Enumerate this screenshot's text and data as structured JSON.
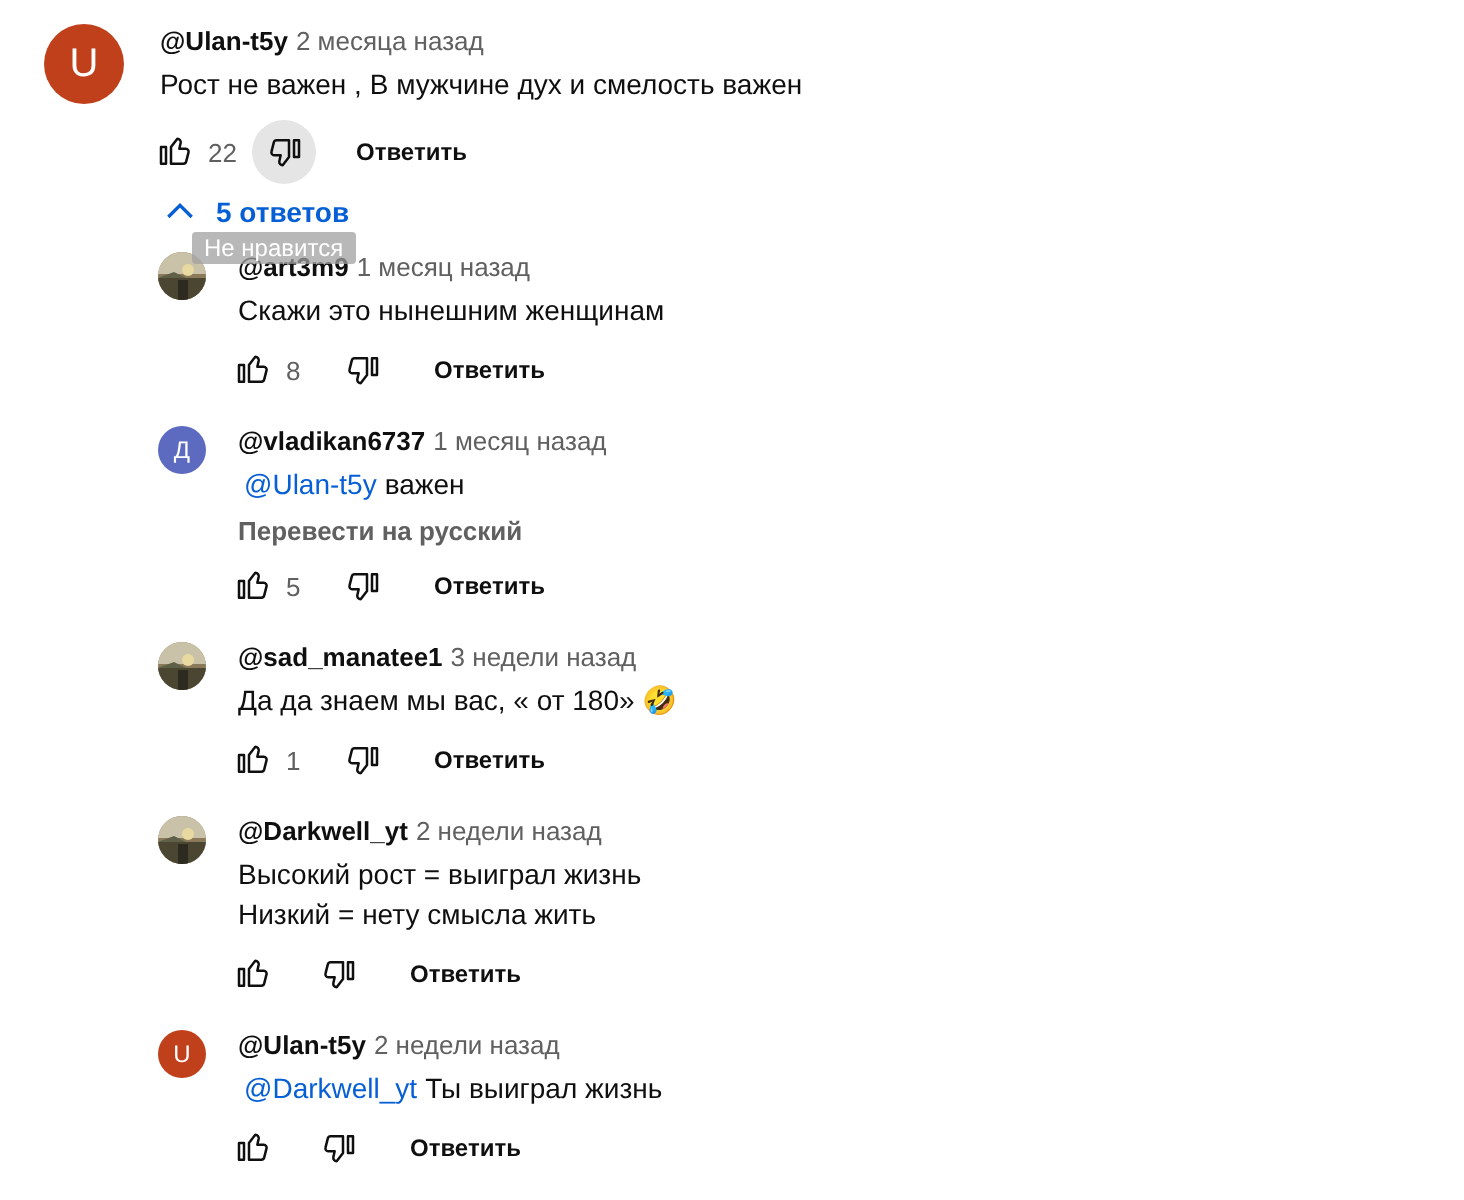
{
  "comment": {
    "avatar": {
      "kind": "letter",
      "letter": "U",
      "color": "#c1401c"
    },
    "author": "@Ulan-t5y",
    "time": "2 месяца назад",
    "text": [
      {
        "kind": "body",
        "text": "Рост не важен , В мужчине дух и смелость важен"
      }
    ],
    "likes": "22",
    "dislike_hovered": true,
    "reply_label": "Ответить",
    "tooltip": "Не нравится"
  },
  "replies_toggle": {
    "label": "5 ответов",
    "expanded": true
  },
  "replies": [
    {
      "avatar": {
        "kind": "picture"
      },
      "author": "@art3m9",
      "time": "1 месяц назад",
      "text": [
        {
          "kind": "body",
          "text": "Скажи это нынешним женщинам"
        }
      ],
      "likes": "8",
      "reply_label": "Ответить"
    },
    {
      "avatar": {
        "kind": "letter",
        "letter": "Д",
        "color": "#5c6bc0"
      },
      "author": "@vladikan6737",
      "time": "1 месяц назад",
      "text": [
        {
          "kind": "mention",
          "text": "@Ulan-t5y"
        },
        {
          "kind": "body",
          "text": "важен"
        }
      ],
      "translate": "Перевести на русский",
      "likes": "5",
      "reply_label": "Ответить"
    },
    {
      "avatar": {
        "kind": "picture"
      },
      "author": "@sad_manatee1",
      "time": "3 недели назад",
      "text": [
        {
          "kind": "body",
          "text": "Да да знаем мы вас, « от 180» 🤣"
        }
      ],
      "likes": "1",
      "reply_label": "Ответить"
    },
    {
      "avatar": {
        "kind": "picture"
      },
      "author": "@Darkwell_yt",
      "time": "2 недели назад",
      "text": [
        {
          "kind": "body",
          "text": "Высокий рост = выиграл жизнь"
        },
        {
          "kind": "break"
        },
        {
          "kind": "body",
          "text": "Низкий = нету смысла жить"
        }
      ],
      "reply_label": "Ответить"
    },
    {
      "avatar": {
        "kind": "letter",
        "letter": "U",
        "color": "#c1401c"
      },
      "author": "@Ulan-t5y",
      "time": "2 недели назад",
      "text": [
        {
          "kind": "mention",
          "text": "@Darkwell_yt"
        },
        {
          "kind": "body",
          "text": "Ты выиграл жизнь"
        }
      ],
      "reply_label": "Ответить"
    }
  ]
}
